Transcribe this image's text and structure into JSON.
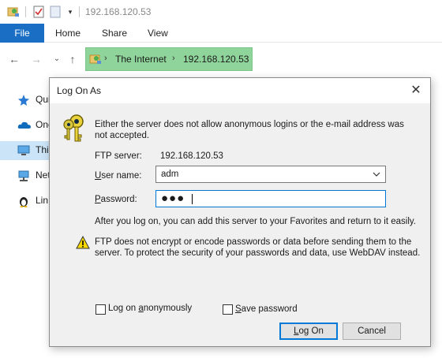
{
  "window": {
    "title": "192.168.120.53"
  },
  "ribbon": {
    "file": "File",
    "tabs": [
      "Home",
      "Share",
      "View"
    ]
  },
  "address": {
    "parts": [
      "The Internet",
      "192.168.120.53"
    ],
    "highlight_color": "#8fd49a"
  },
  "sidebar": {
    "items": [
      {
        "label": "Qui",
        "icon": "star-icon"
      },
      {
        "label": "One",
        "icon": "onedrive-cloud-icon"
      },
      {
        "label": "Thi",
        "icon": "this-pc-icon"
      },
      {
        "label": "Net",
        "icon": "network-icon"
      },
      {
        "label": "Lin",
        "icon": "linux-penguin-icon"
      }
    ]
  },
  "dialog": {
    "title": "Log On As",
    "message": "Either the server does not allow anonymous logins or the e-mail address was not accepted.",
    "ftp_server_label": "FTP server:",
    "ftp_server_value": "192.168.120.53",
    "user_name_label_u": "U",
    "user_name_label_rest": "ser name:",
    "user_name_value": "adm",
    "password_label_p": "P",
    "password_label_rest": "assword:",
    "password_mask": "●●●",
    "info": "After you log on, you can add this server to your Favorites and return to it easily.",
    "warning": "FTP does not encrypt or encode passwords or data before sending them to the server.  To protect the security of your passwords and data, use WebDAV instead.",
    "anon_label_pre": "Log on ",
    "anon_label_a": "a",
    "anon_label_post": "nonymously",
    "save_label_s": "S",
    "save_label_rest": "ave password",
    "logon_button_pre": "",
    "logon_button_l": "L",
    "logon_button_post": "og On",
    "cancel_button": "Cancel",
    "accent_color": "#0078d7"
  }
}
